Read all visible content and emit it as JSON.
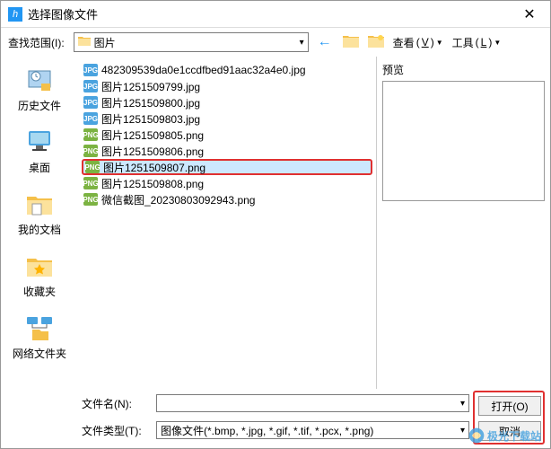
{
  "titlebar": {
    "icon": "h",
    "title": "选择图像文件"
  },
  "toolbar": {
    "lookin_label": "查找范围(I):",
    "location": "图片",
    "view_label": "查看",
    "view_key": "V",
    "tools_label": "工具",
    "tools_key": "L"
  },
  "sidebar": {
    "items": [
      {
        "label": "历史文件"
      },
      {
        "label": "桌面"
      },
      {
        "label": "我的文档"
      },
      {
        "label": "收藏夹"
      },
      {
        "label": "网络文件夹"
      }
    ]
  },
  "files": [
    {
      "name": "482309539da0e1ccdfbed91aac32a4e0.jpg",
      "type": "jpg",
      "icon_label": "JPG",
      "selected": false,
      "highlighted": false
    },
    {
      "name": "图片1251509799.jpg",
      "type": "jpg",
      "icon_label": "JPG",
      "selected": false,
      "highlighted": false
    },
    {
      "name": "图片1251509800.jpg",
      "type": "jpg",
      "icon_label": "JPG",
      "selected": false,
      "highlighted": false
    },
    {
      "name": "图片1251509803.jpg",
      "type": "jpg",
      "icon_label": "JPG",
      "selected": false,
      "highlighted": false
    },
    {
      "name": "图片1251509805.png",
      "type": "png",
      "icon_label": "PNG",
      "selected": false,
      "highlighted": false
    },
    {
      "name": "图片1251509806.png",
      "type": "png",
      "icon_label": "PNG",
      "selected": false,
      "highlighted": false
    },
    {
      "name": "图片1251509807.png",
      "type": "png",
      "icon_label": "PNG",
      "selected": true,
      "highlighted": true
    },
    {
      "name": "图片1251509808.png",
      "type": "png",
      "icon_label": "PNG",
      "selected": false,
      "highlighted": false
    },
    {
      "name": "微信截图_20230803092943.png",
      "type": "png",
      "icon_label": "PNG",
      "selected": false,
      "highlighted": false
    }
  ],
  "preview": {
    "label": "预览"
  },
  "bottom": {
    "filename_label": "文件名(N):",
    "filename_value": "",
    "filetype_label": "文件类型(T):",
    "filetype_value": "图像文件(*.bmp, *.jpg, *.gif, *.tif, *.pcx, *.png)",
    "open_label": "打开(O)",
    "cancel_label": "取消"
  },
  "watermark": "极光下载站"
}
